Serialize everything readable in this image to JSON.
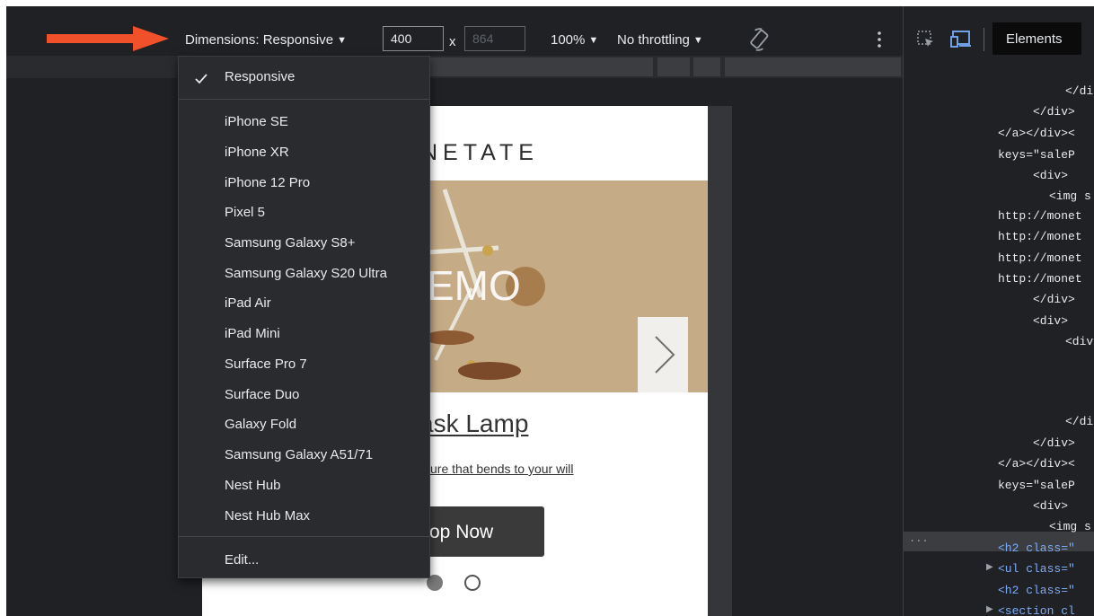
{
  "toolbar": {
    "dimensions_label": "Dimensions: Responsive",
    "width_value": "400",
    "height_value": "864",
    "times_symbol": "x",
    "zoom_label": "100%",
    "throttle_label": "No throttling",
    "arrow_color": "#f0502a"
  },
  "dimensions_menu": {
    "selected": "Responsive",
    "devices": [
      "iPhone SE",
      "iPhone XR",
      "iPhone 12 Pro",
      "Pixel 5",
      "Samsung Galaxy S8+",
      "Samsung Galaxy S20 Ultra",
      "iPad Air",
      "iPad Mini",
      "Surface Pro 7",
      "Surface Duo",
      "Galaxy Fold",
      "Samsung Galaxy A51/71",
      "Nest Hub",
      "Nest Hub Max"
    ],
    "edit_label": "Edit..."
  },
  "page_preview": {
    "brand": "NETATE",
    "hero_text": "EMO",
    "product_title": "ask Lamp",
    "product_subtitle": "ure that bends to your will",
    "cta_label": "op Now"
  },
  "devtools": {
    "active_tab": "Elements",
    "dom_lines": [
      "</di",
      "</div>",
      "</a></div><",
      "keys=\"saleP",
      "<div>",
      "<img s",
      "http://monet",
      "http://monet",
      "http://monet",
      "http://monet",
      "</div>",
      "<div>",
      "<div",
      "</di",
      "</div>",
      "</a></div><",
      "keys=\"saleP",
      "<div>",
      "<img s",
      "<h2 class=\"",
      "<ul class=\"",
      "<h2 class=\"",
      "<section cl"
    ],
    "ellipsis": "..."
  }
}
